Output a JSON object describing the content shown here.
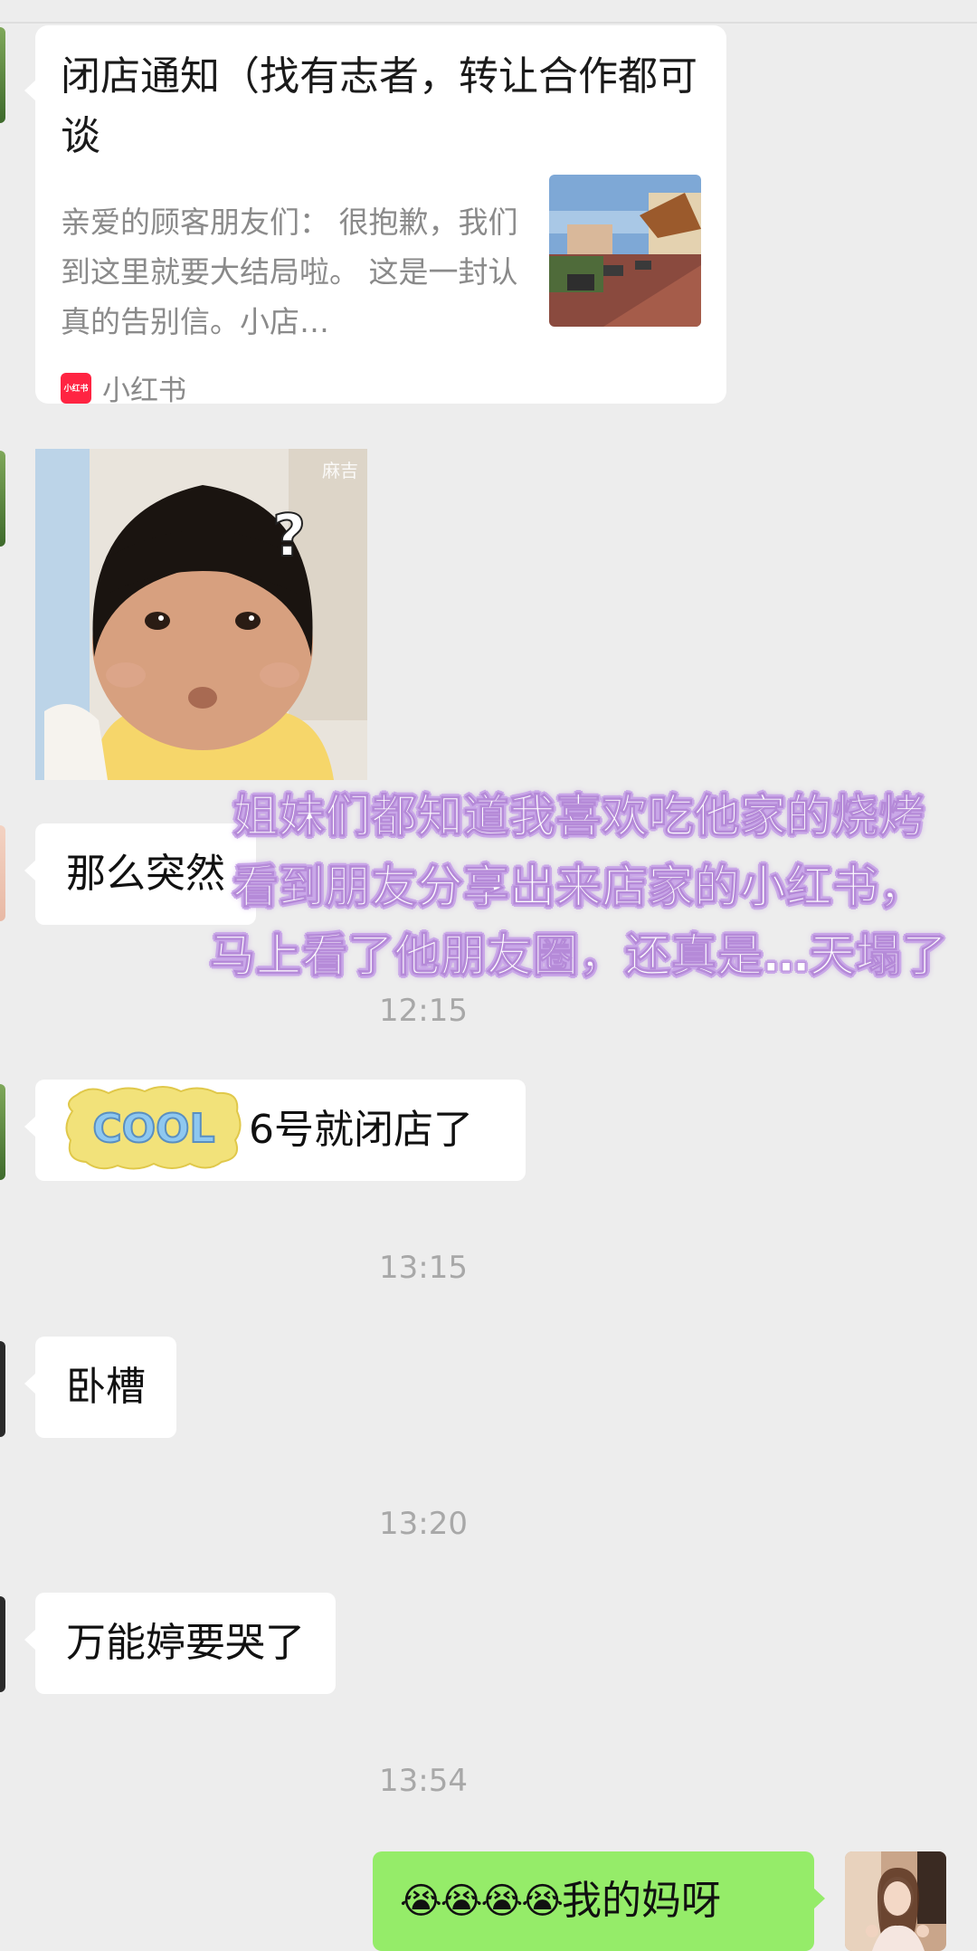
{
  "chat": {
    "card": {
      "title": "闭店通知（找有志者，转让合作都可谈",
      "description": "亲爱的顾客朋友们： 很抱歉，我们到这里就要大结局啦。 这是一封认真的告别信。小店…",
      "source_logo": "小红书",
      "source_name": "小红书"
    },
    "sticker": {
      "watermark": "麻吉",
      "symbol": "?"
    },
    "messages": [
      {
        "text": "那么突然"
      },
      {
        "text": "6号就闭店了"
      },
      {
        "text": "卧槽"
      },
      {
        "text": "万能婷要哭了"
      }
    ],
    "timestamps": [
      "12:15",
      "13:15",
      "13:20",
      "13:54"
    ],
    "my_message": {
      "emoji": "😭😭😭😭",
      "text": "我的妈呀"
    },
    "cool_sticker": "COOL"
  },
  "overlay": {
    "lines": [
      "姐妹们都知道我喜欢吃他家的烧烤",
      "看到朋友分享出来店家的小红书，",
      "马上看了他朋友圈，还真是…天塌了"
    ]
  },
  "colors": {
    "background": "#ededed",
    "received_bubble": "#ffffff",
    "sent_bubble": "#95ec69",
    "timestamp": "#a8a8a8",
    "overlay_text": "#ffffff",
    "overlay_outline": "#c9a7e8"
  }
}
